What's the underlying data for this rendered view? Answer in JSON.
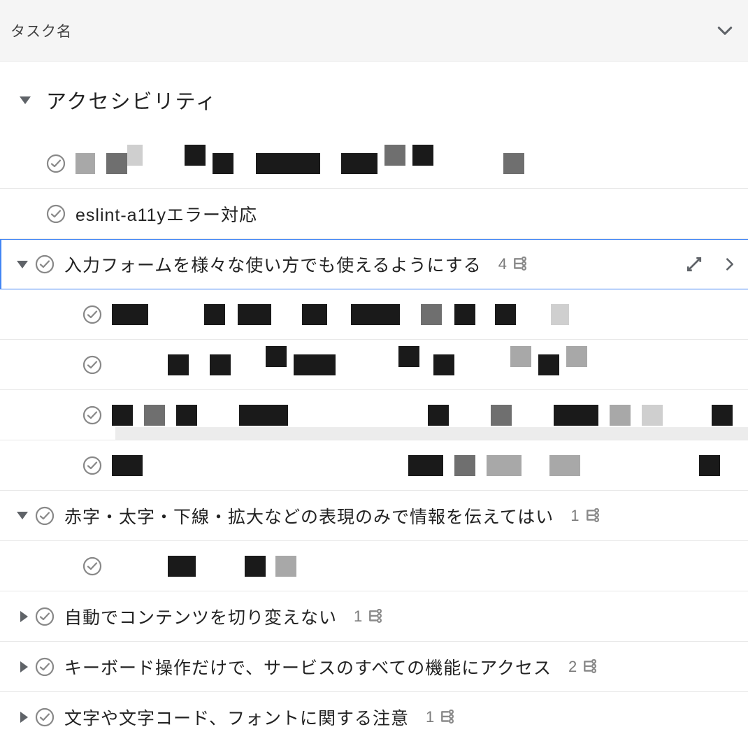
{
  "header": {
    "title": "タスク名"
  },
  "section": {
    "title": "アクセシビリティ"
  },
  "tasks": [
    {
      "id": "t1",
      "level": 1,
      "title_redacted": true,
      "expanded": null,
      "has_children": false
    },
    {
      "id": "t2",
      "level": 1,
      "title": "eslint-a11yエラー対応",
      "expanded": null,
      "has_children": false
    },
    {
      "id": "t3",
      "level": 1,
      "title": "入力フォームを様々な使い方でも使えるようにする",
      "expanded": true,
      "has_children": true,
      "subtask_count": 4,
      "selected": true,
      "children": [
        {
          "id": "t3a",
          "level": 2,
          "title_redacted": true
        },
        {
          "id": "t3b",
          "level": 2,
          "title_redacted": true
        },
        {
          "id": "t3c",
          "level": 2,
          "title_redacted": true
        },
        {
          "id": "t3d",
          "level": 2,
          "title_redacted": true,
          "show_scroll": true
        }
      ]
    },
    {
      "id": "t4",
      "level": 1,
      "title": "赤字・太字・下線・拡大などの表現のみで情報を伝えてはい",
      "expanded": true,
      "has_children": true,
      "subtask_count": 1,
      "children": [
        {
          "id": "t4a",
          "level": 2,
          "title_redacted": true
        }
      ]
    },
    {
      "id": "t5",
      "level": 1,
      "title": "自動でコンテンツを切り変えない",
      "expanded": false,
      "has_children": true,
      "subtask_count": 1
    },
    {
      "id": "t6",
      "level": 1,
      "title": "キーボード操作だけで、サービスのすべての機能にアクセス",
      "expanded": false,
      "has_children": true,
      "subtask_count": 2
    },
    {
      "id": "t7",
      "level": 1,
      "title": "文字や文字コード、フォントに関する注意",
      "expanded": false,
      "has_children": true,
      "subtask_count": 1
    }
  ],
  "icons": {
    "subtask": "subtask-tree",
    "check": "check-circle",
    "move": "swap-diagonal",
    "chevron_right": "chevron-right",
    "chevron_down": "chevron-down"
  }
}
